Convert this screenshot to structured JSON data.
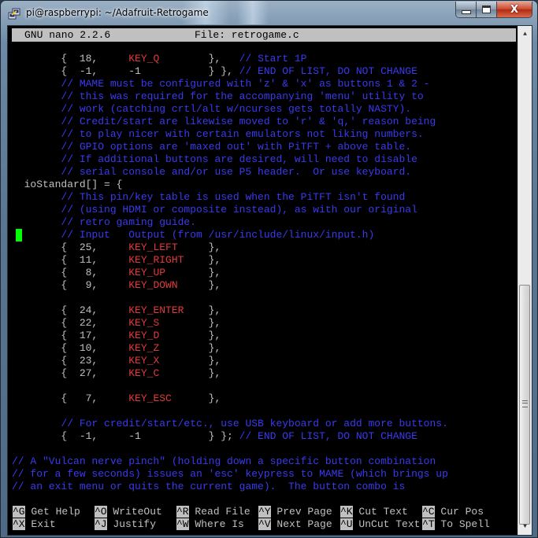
{
  "window": {
    "title": "pi@raspberrypi: ~/Adafruit-Retrogame",
    "icon": "putty-icon",
    "controls": {
      "minimize": "minimize-icon",
      "maximize": "maximize-icon",
      "close": "close-icon"
    }
  },
  "nano": {
    "version_label": "GNU nano 2.2.6",
    "file_label": "File: retrogame.c",
    "colors": {
      "comment": "#3a3af0",
      "key": "#e03a3a",
      "plain": "#c0c0c0",
      "cursor": "#00ff00",
      "header_bg": "#c0c0c0"
    },
    "lines": [
      [
        {
          "t": "        {  18,     ",
          "c": "plain"
        },
        {
          "t": "KEY_Q",
          "c": "key"
        },
        {
          "t": "        },   ",
          "c": "plain"
        },
        {
          "t": "// Start 1P",
          "c": "cm"
        }
      ],
      [
        {
          "t": "        {  -1,     -1           } }, ",
          "c": "plain"
        },
        {
          "t": "// END OF LIST, DO NOT CHANGE",
          "c": "cm"
        }
      ],
      [
        {
          "t": "        // MAME must be configured with 'z' & 'x' as buttons 1 & 2 -",
          "c": "cm"
        }
      ],
      [
        {
          "t": "        // this was required for the accompanying 'menu' utility to",
          "c": "cm"
        }
      ],
      [
        {
          "t": "        // work (catching crtl/alt w/ncurses gets totally NASTY).",
          "c": "cm"
        }
      ],
      [
        {
          "t": "        // Credit/start are likewise moved to 'r' & 'q,' reason being",
          "c": "cm"
        }
      ],
      [
        {
          "t": "        // to play nicer with certain emulators not liking numbers.",
          "c": "cm"
        }
      ],
      [
        {
          "t": "        // GPIO options are 'maxed out' with PiTFT + above table.",
          "c": "cm"
        }
      ],
      [
        {
          "t": "        // If additional buttons are desired, will need to disable",
          "c": "cm"
        }
      ],
      [
        {
          "t": "        // serial console and/or use P5 header.  Or use keyboard.",
          "c": "cm"
        }
      ],
      [
        {
          "t": "  ioStandard[] = {",
          "c": "plain"
        }
      ],
      [
        {
          "t": "        // This pin/key table is used when the PiTFT isn't found",
          "c": "cm"
        }
      ],
      [
        {
          "t": "        // (using HDMI or composite instead), as with our original",
          "c": "cm"
        }
      ],
      [
        {
          "t": "        // retro gaming guide.",
          "c": "cm"
        }
      ],
      [
        {
          "t": "        // Input   Output (from /usr/include/linux/input.h)",
          "c": "cm"
        }
      ],
      [
        {
          "t": "        {  25,     ",
          "c": "plain"
        },
        {
          "t": "KEY_LEFT",
          "c": "key"
        },
        {
          "t": "     },",
          "c": "plain"
        }
      ],
      [
        {
          "t": "        {  11,     ",
          "c": "plain"
        },
        {
          "t": "KEY_RIGHT",
          "c": "key"
        },
        {
          "t": "    },",
          "c": "plain"
        }
      ],
      [
        {
          "t": "        {   8,     ",
          "c": "plain"
        },
        {
          "t": "KEY_UP",
          "c": "key"
        },
        {
          "t": "       },",
          "c": "plain"
        }
      ],
      [
        {
          "t": "        {   9,     ",
          "c": "plain"
        },
        {
          "t": "KEY_DOWN",
          "c": "key"
        },
        {
          "t": "     },",
          "c": "plain"
        }
      ],
      [
        {
          "t": "",
          "c": "plain"
        }
      ],
      [
        {
          "t": "        {  24,     ",
          "c": "plain"
        },
        {
          "t": "KEY_ENTER",
          "c": "key"
        },
        {
          "t": "    },",
          "c": "plain"
        }
      ],
      [
        {
          "t": "        {  22,     ",
          "c": "plain"
        },
        {
          "t": "KEY_S",
          "c": "key"
        },
        {
          "t": "        },",
          "c": "plain"
        }
      ],
      [
        {
          "t": "        {  17,     ",
          "c": "plain"
        },
        {
          "t": "KEY_D",
          "c": "key"
        },
        {
          "t": "        },",
          "c": "plain"
        }
      ],
      [
        {
          "t": "        {  10,     ",
          "c": "plain"
        },
        {
          "t": "KEY_Z",
          "c": "key"
        },
        {
          "t": "        },",
          "c": "plain"
        }
      ],
      [
        {
          "t": "        {  23,     ",
          "c": "plain"
        },
        {
          "t": "KEY_X",
          "c": "key"
        },
        {
          "t": "        },",
          "c": "plain"
        }
      ],
      [
        {
          "t": "        {  27,     ",
          "c": "plain"
        },
        {
          "t": "KEY_C",
          "c": "key"
        },
        {
          "t": "        },",
          "c": "plain"
        }
      ],
      [
        {
          "t": "",
          "c": "plain"
        }
      ],
      [
        {
          "t": "        {   7,     ",
          "c": "plain"
        },
        {
          "t": "KEY_ESC",
          "c": "key"
        },
        {
          "t": "      },",
          "c": "plain"
        }
      ],
      [
        {
          "t": "",
          "c": "plain"
        }
      ],
      [
        {
          "t": "        // For credit/start/etc., use USB keyboard or add more buttons.",
          "c": "cm"
        }
      ],
      [
        {
          "t": "        {  -1,     -1           } }; ",
          "c": "plain"
        },
        {
          "t": "// END OF LIST, DO NOT CHANGE",
          "c": "cm"
        }
      ],
      [
        {
          "t": "",
          "c": "plain"
        }
      ],
      [
        {
          "t": "// A \"Vulcan nerve pinch\" (holding down a specific button combination",
          "c": "cm"
        }
      ],
      [
        {
          "t": "// for a few seconds) issues an 'esc' keypress to MAME (which brings up",
          "c": "cm"
        }
      ],
      [
        {
          "t": "// an exit menu or quits the current game).  The button combo is",
          "c": "cm"
        }
      ]
    ],
    "shortcuts": [
      [
        {
          "key": "^G",
          "label": " Get Help  "
        },
        {
          "key": "^O",
          "label": " WriteOut  "
        },
        {
          "key": "^R",
          "label": " Read File "
        },
        {
          "key": "^Y",
          "label": " Prev Page "
        },
        {
          "key": "^K",
          "label": " Cut Text  "
        },
        {
          "key": "^C",
          "label": " Cur Pos"
        }
      ],
      [
        {
          "key": "^X",
          "label": " Exit      "
        },
        {
          "key": "^J",
          "label": " Justify   "
        },
        {
          "key": "^W",
          "label": " Where Is  "
        },
        {
          "key": "^V",
          "label": " Next Page "
        },
        {
          "key": "^U",
          "label": " UnCut Text"
        },
        {
          "key": "^T",
          "label": " To Spell"
        }
      ]
    ]
  },
  "scrollbar": {
    "up_icon": "scroll-up-arrow-icon",
    "down_icon": "scroll-down-arrow-icon",
    "position_fraction": 0.52,
    "visible_fraction": 0.48
  }
}
